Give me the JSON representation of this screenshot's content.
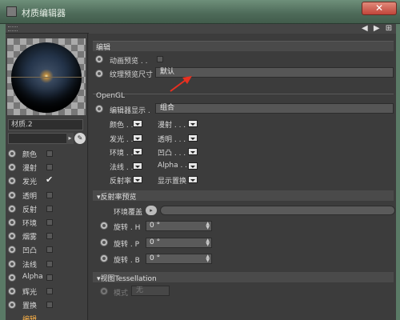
{
  "window": {
    "title": "材质编辑器",
    "close_label": "✕"
  },
  "toolbar": {
    "nav_arrows": "◀ ▶ ⊞"
  },
  "material": {
    "name": "材质.2"
  },
  "channels": [
    {
      "label": "颜色",
      "checked": false
    },
    {
      "label": "漫射",
      "checked": false
    },
    {
      "label": "发光",
      "checked": true
    },
    {
      "label": "透明",
      "checked": false
    },
    {
      "label": "反射",
      "checked": false
    },
    {
      "label": "环境",
      "checked": false
    },
    {
      "label": "烟雾",
      "checked": false
    },
    {
      "label": "凹凸",
      "checked": false
    },
    {
      "label": "法线",
      "checked": false
    },
    {
      "label": "Alpha",
      "checked": false
    },
    {
      "label": "辉光",
      "checked": false
    },
    {
      "label": "置换",
      "checked": false
    },
    {
      "label": "编辑",
      "active": true
    }
  ],
  "editor": {
    "tab": "编辑",
    "anim_preview": "动画预览 . .",
    "tex_preview_size": "纹理预览尺寸",
    "tex_preview_value": "默认",
    "opengl": "OpenGL",
    "editor_display": "编辑器显示 .",
    "editor_display_value": "组合",
    "toggles_left": [
      "颜色 . .",
      "发光 . .",
      "环境 . .",
      "法线 . .",
      "反射率"
    ],
    "toggles_right": [
      "漫射 . . . .",
      "透明 . . . .",
      "凹凸 . . . .",
      "Alpha . . . .",
      "显示置换"
    ]
  },
  "reflectance": {
    "header": "▾反射率预览",
    "env_label": "环境覆盖",
    "env_btn": "▸",
    "rotations": [
      {
        "label": "旋转 . H",
        "value": "0 °"
      },
      {
        "label": "旋转 . P",
        "value": "0 °"
      },
      {
        "label": "旋转 . B",
        "value": "0 °"
      }
    ]
  },
  "tessellation": {
    "header": "▾视图Tessellation",
    "mode_label": "模式",
    "mode_value": "无"
  },
  "colors": {
    "accent_orange": "#ffb347",
    "annotation_arrow": "#e83020"
  }
}
